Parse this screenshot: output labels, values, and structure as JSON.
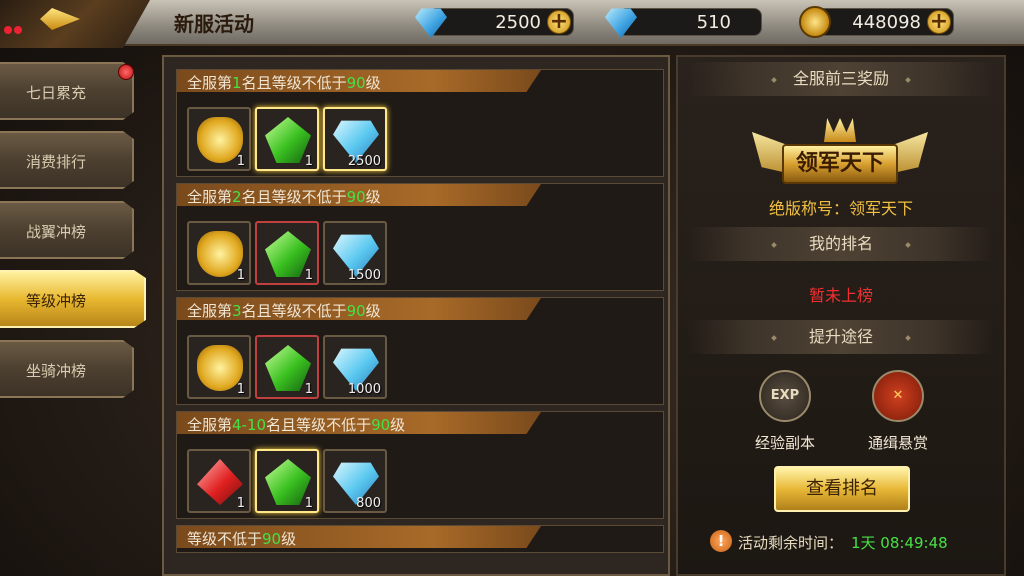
{
  "header": {
    "title": "新服活动"
  },
  "currencies": [
    {
      "icon": "diamond-icon",
      "value": "2500"
    },
    {
      "icon": "locked-diamond-icon",
      "value": "510"
    },
    {
      "icon": "gold-coin-icon",
      "value": "448098"
    }
  ],
  "sidebar": {
    "items": [
      {
        "label": "七日累充",
        "badge": true
      },
      {
        "label": "消费排行"
      },
      {
        "label": "战翼冲榜"
      },
      {
        "label": "等级冲榜",
        "active": true
      },
      {
        "label": "坐骑冲榜"
      }
    ]
  },
  "rewards": [
    {
      "prefix": "全服第",
      "rank": "1",
      "mid": "名且等级不低于",
      "level": "90",
      "suffix": "级",
      "items": [
        {
          "icon": "gold-ingot-icon",
          "count": "1"
        },
        {
          "icon": "emerald-icon",
          "count": "1"
        },
        {
          "icon": "diamond-icon",
          "count": "2500"
        }
      ]
    },
    {
      "prefix": "全服第",
      "rank": "2",
      "mid": "名且等级不低于",
      "level": "90",
      "suffix": "级",
      "items": [
        {
          "icon": "gold-ingot-icon",
          "count": "1"
        },
        {
          "icon": "emerald-icon",
          "count": "1"
        },
        {
          "icon": "diamond-icon",
          "count": "1500"
        }
      ]
    },
    {
      "prefix": "全服第",
      "rank": "3",
      "mid": "名且等级不低于",
      "level": "90",
      "suffix": "级",
      "items": [
        {
          "icon": "gold-ingot-icon",
          "count": "1"
        },
        {
          "icon": "emerald-icon",
          "count": "1"
        },
        {
          "icon": "diamond-icon",
          "count": "1000"
        }
      ]
    },
    {
      "prefix": "全服第",
      "rank": "4-10",
      "mid": "名且等级不低于",
      "level": "90",
      "suffix": "级",
      "items": [
        {
          "icon": "ruby-icon",
          "count": "1"
        },
        {
          "icon": "emerald-icon",
          "count": "1"
        },
        {
          "icon": "diamond-icon",
          "count": "800"
        }
      ]
    },
    {
      "prefix": "",
      "rank": "",
      "mid": "等级不低于",
      "level": "90",
      "suffix": "级",
      "items": []
    }
  ],
  "right": {
    "top3_header": "全服前三奖励",
    "badge_text": "领军天下",
    "full_title": "绝版称号：领军天下",
    "my_rank_header": "我的排名",
    "my_rank_value": "暂未上榜",
    "improve_header": "提升途径",
    "ways": [
      {
        "icon": "exp-dungeon-icon",
        "icon_text": "EXP",
        "label": "经验副本"
      },
      {
        "icon": "bounty-icon",
        "icon_text": "",
        "label": "通缉悬赏"
      }
    ],
    "view_button": "查看排名",
    "timer_label": "活动剩余时间：",
    "timer_value": "1天 08:49:48"
  }
}
